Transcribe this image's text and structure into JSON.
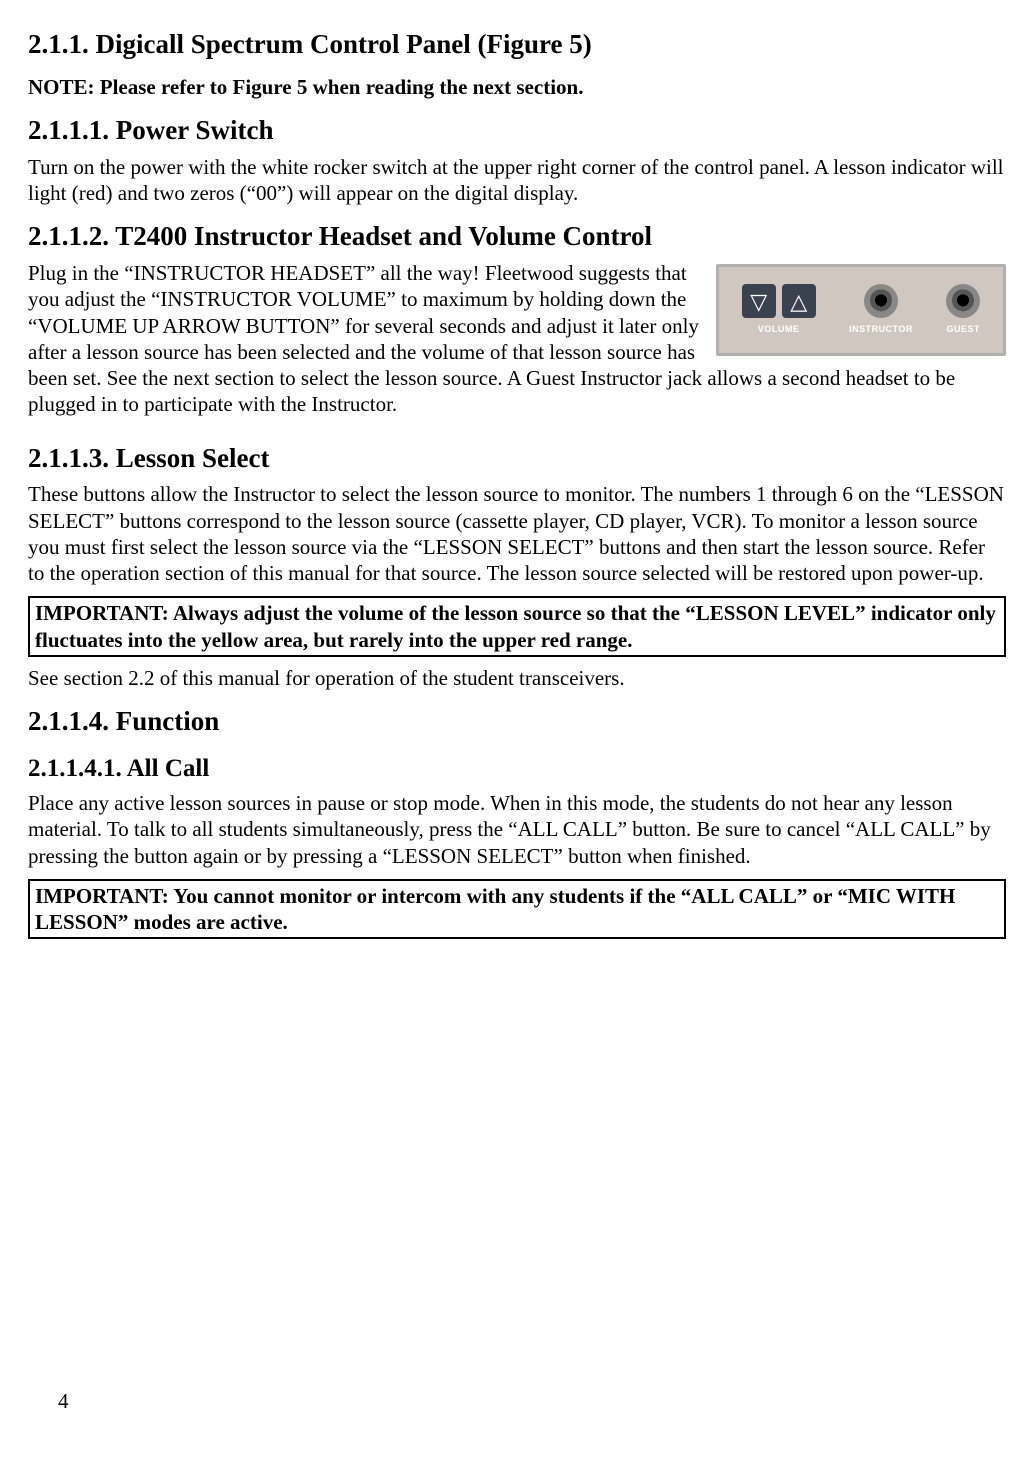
{
  "section211": {
    "heading": "2.1.1. Digicall Spectrum Control Panel (Figure 5)",
    "note": "NOTE: Please refer to Figure 5 when reading the next section."
  },
  "section2111": {
    "heading": "2.1.1.1. Power Switch",
    "body": "Turn on the power with the white rocker switch at the upper right corner of the control panel.  A lesson indicator will light (red) and two zeros (“00”) will appear on the digital display."
  },
  "section2112": {
    "heading": "2.1.1.2. T2400 Instructor Headset and Volume Control",
    "body": "Plug in the “INSTRUCTOR HEADSET” all the way! Fleetwood suggests that you adjust the “INSTRUCTOR VOLUME” to maximum by holding down the “VOLUME UP ARROW BUTTON” for several seconds and adjust it later only after a lesson source has been selected and the volume of that lesson source has been set. See the next section to select the lesson source. A Guest Instructor jack allows a second headset to be plugged in to participate with the Instructor.",
    "panel": {
      "label_volume": "VOLUME",
      "label_instructor": "INSTRUCTOR",
      "label_guest": "GUEST"
    }
  },
  "section2113": {
    "heading": "2.1.1.3. Lesson Select",
    "body": "These buttons allow the Instructor to select the lesson source to monitor. The numbers 1 through 6 on the “LESSON SELECT” buttons correspond to the lesson source (cassette player, CD player, VCR). To monitor a lesson source you must first select the lesson source via the “LESSON SELECT” buttons and then start the lesson source.  Refer to the operation section of this manual for that source.  The lesson source selected will be restored upon power-up.",
    "important": "IMPORTANT: Always adjust the volume of the lesson source so that the “LESSON LEVEL” indicator only fluctuates into the yellow area, but rarely into the upper red range.",
    "after_important": "See section 2.2 of this manual for operation of the student transceivers."
  },
  "section2114": {
    "heading": "2.1.1.4. Function"
  },
  "section21141": {
    "heading": "2.1.1.4.1.  All Call",
    "body": "Place any active lesson sources in pause or stop mode. When in this mode, the students do not hear any lesson material. To talk to all students simultaneously, press the  “ALL CALL” button. Be sure to cancel “ALL CALL” by pressing the button again or by pressing a “LESSON SELECT” button when finished.",
    "important": "IMPORTANT: You cannot monitor or intercom with any students if the “ALL CALL” or “MIC WITH LESSON” modes are active."
  },
  "page_number": "4"
}
